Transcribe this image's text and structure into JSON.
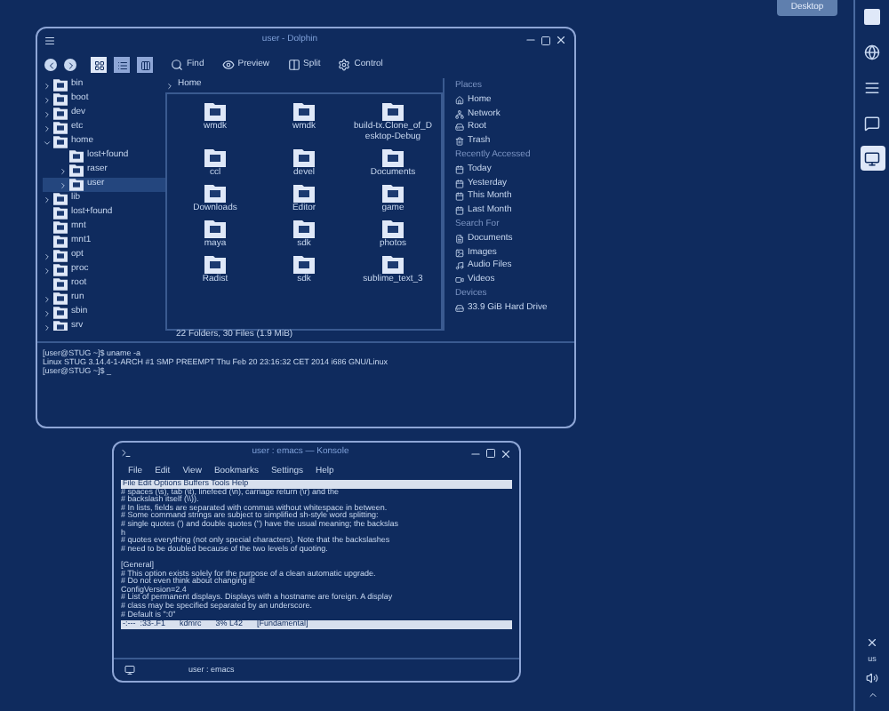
{
  "tooltip": {
    "label": "Desktop"
  },
  "dolphin": {
    "title": "user - Dolphin",
    "view_modes": [
      {
        "selected": true
      },
      {
        "selected": false
      },
      {
        "selected": false
      }
    ],
    "actions": [
      {
        "kind": "find",
        "label": "Find"
      },
      {
        "kind": "preview",
        "label": "Preview"
      },
      {
        "kind": "split",
        "label": "Split"
      },
      {
        "kind": "control",
        "label": "Control"
      }
    ],
    "tree": [
      {
        "label": "bin",
        "expandable": true
      },
      {
        "label": "boot",
        "expandable": true
      },
      {
        "label": "dev",
        "expandable": true
      },
      {
        "label": "etc",
        "expandable": true
      },
      {
        "label": "home",
        "expandable": true,
        "expanded": true,
        "children": [
          {
            "label": "lost+found",
            "expandable": false,
            "selected": false
          },
          {
            "label": "raser",
            "expandable": true,
            "selected": false
          },
          {
            "label": "user",
            "expandable": true,
            "selected": true
          }
        ]
      },
      {
        "label": "lib",
        "expandable": true
      },
      {
        "label": "lost+found",
        "expandable": false
      },
      {
        "label": "mnt",
        "expandable": false
      },
      {
        "label": "mnt1",
        "expandable": false
      },
      {
        "label": "opt",
        "expandable": true
      },
      {
        "label": "proc",
        "expandable": true
      },
      {
        "label": "root",
        "expandable": false
      },
      {
        "label": "run",
        "expandable": true
      },
      {
        "label": "sbin",
        "expandable": true
      },
      {
        "label": "srv",
        "expandable": true
      }
    ],
    "breadcrumb": "Home",
    "files": [
      "wmdk",
      "wmdk",
      "build-tx.Clone_of_Desktop-Debug",
      "ccl",
      "devel",
      "Documents",
      "Downloads",
      "Editor",
      "game",
      "maya",
      "sdk",
      "photos",
      "Radist",
      "sdk",
      "sublime_text_3"
    ],
    "status": "22 Folders, 30 Files (1.9 MiB)",
    "places": [
      {
        "heading": "Places",
        "items": [
          "Home",
          "Network",
          "Root",
          "Trash"
        ]
      },
      {
        "heading": "Recently Accessed",
        "items": [
          "Today",
          "Yesterday",
          "This Month",
          "Last Month"
        ]
      },
      {
        "heading": "Search For",
        "items": [
          "Documents",
          "Images",
          "Audio Files",
          "Videos"
        ]
      },
      {
        "heading": "Devices",
        "items": [
          "33.9 GiB Hard Drive"
        ]
      }
    ],
    "terminal": [
      "[user@STUG ~]$ uname -a",
      "Linux STUG 3.14.4-1-ARCH #1 SMP PREEMPT Thu Feb 20 23:16:32 CET 2014 i686 GNU/Linux",
      "[user@STUG ~]$ _"
    ]
  },
  "konsole": {
    "title": "user : emacs — Konsole",
    "menu": [
      "File",
      "Edit",
      "View",
      "Bookmarks",
      "Settings",
      "Help"
    ],
    "emacs_menu": "File Edit Options Buffers Tools Help",
    "blocks": [
      [
        "# spaces (\\s), tab (\\t), linefeed (\\n), carriage return (\\r) and the",
        "# backslash itself (\\\\)).",
        "# In lists, fields are separated with commas without whitespace in between.",
        "# Some command strings are subject to simplified sh-style word splitting:",
        "# single quotes (') and double quotes (\") have the usual meaning; the backslas",
        "h",
        "# quotes everything (not only special characters). Note that the backslashes",
        "# need to be doubled because of the two levels of quoting."
      ],
      [
        "[General]",
        "# This option exists solely for the purpose of a clean automatic upgrade.",
        "# Do not even think about changing it!",
        "ConfigVersion=2.4",
        "# List of permanent displays. Displays with a hostname are foreign. A display",
        "# class may be specified separated by an underscore.",
        "# Default is \":0\""
      ]
    ],
    "modeline": [
      "-:---  :33-.F1",
      "kdmrc",
      "3% L42",
      "[Fundamental]"
    ],
    "tab": "user : emacs"
  },
  "panel": {
    "launchers": [
      {
        "kind": "logo",
        "selected": false
      },
      {
        "kind": "globe",
        "selected": false
      },
      {
        "kind": "list",
        "selected": false
      },
      {
        "kind": "chat",
        "selected": false
      },
      {
        "kind": "monitor",
        "selected": true
      }
    ],
    "keyboard": "us"
  }
}
